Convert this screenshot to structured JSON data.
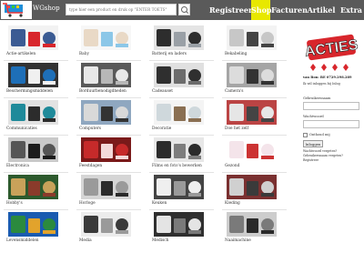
{
  "header": {
    "logo_text": "WGshop",
    "search": {
      "placeholder": "type hier een product en druk op \"ENTER TOETS\""
    },
    "nav": [
      {
        "label": "Registreer",
        "active": false
      },
      {
        "label": "Shop",
        "active": true
      },
      {
        "label": "Facturen",
        "active": false
      },
      {
        "label": "Artikel ?",
        "active": false
      },
      {
        "label": "Extra",
        "active": false
      }
    ]
  },
  "categories": [
    {
      "label": "Actie-artikelen",
      "icon": "sale-icon"
    },
    {
      "label": "Baby",
      "icon": "baby-icon"
    },
    {
      "label": "Batterij en laders",
      "icon": "battery-icon"
    },
    {
      "label": "Bekabeling",
      "icon": "cable-icon"
    },
    {
      "label": "Beschermingsmiddelen",
      "icon": "phone-case-icon"
    },
    {
      "label": "Borduurbenodigdheden",
      "icon": "sewing-icon"
    },
    {
      "label": "Cadeauset",
      "icon": "gift-icon"
    },
    {
      "label": "Camera's",
      "icon": "camera-icon"
    },
    {
      "label": "Communicaties",
      "icon": "chat-icon"
    },
    {
      "label": "Computers",
      "icon": "computer-icon"
    },
    {
      "label": "Decoratie",
      "icon": "decor-icon"
    },
    {
      "label": "Doe het zelf",
      "icon": "tools-icon"
    },
    {
      "label": "Electronica",
      "icon": "electronics-icon"
    },
    {
      "label": "Feestdagen",
      "icon": "party-icon"
    },
    {
      "label": "Films en foto's bewerken",
      "icon": "film-icon"
    },
    {
      "label": "Gezond",
      "icon": "health-icon"
    },
    {
      "label": "Hobby's",
      "icon": "hobby-icon"
    },
    {
      "label": "Horloge",
      "icon": "watch-icon"
    },
    {
      "label": "Keuken",
      "icon": "kitchen-icon"
    },
    {
      "label": "Kleding",
      "icon": "clothing-icon"
    },
    {
      "label": "Levensmiddelen",
      "icon": "food-icon"
    },
    {
      "label": "Media",
      "icon": "media-icon"
    },
    {
      "label": "Medisch",
      "icon": "medical-icon"
    },
    {
      "label": "Naaimachine",
      "icon": "sewing-machine-icon"
    }
  ],
  "sidebar": {
    "brand_text": "ACTIES",
    "phone": "van Bon: BE 0729.298.289",
    "account_link": "Ik wil inloggen bij Inlog",
    "username_label": "Gebruikersnaam",
    "password_label": "Wachtwoord",
    "remember_label": "Onthoud mij",
    "login_button": "Inloggen",
    "forgot_password": "Wachtwoord vergeten?",
    "forgot_username": "Gebruikersnaam vergeten?",
    "register": "Registreer"
  },
  "colors": {
    "topbar": "#5a5a5a",
    "active_tab": "#e8e800",
    "brand_red": "#d8262c"
  }
}
